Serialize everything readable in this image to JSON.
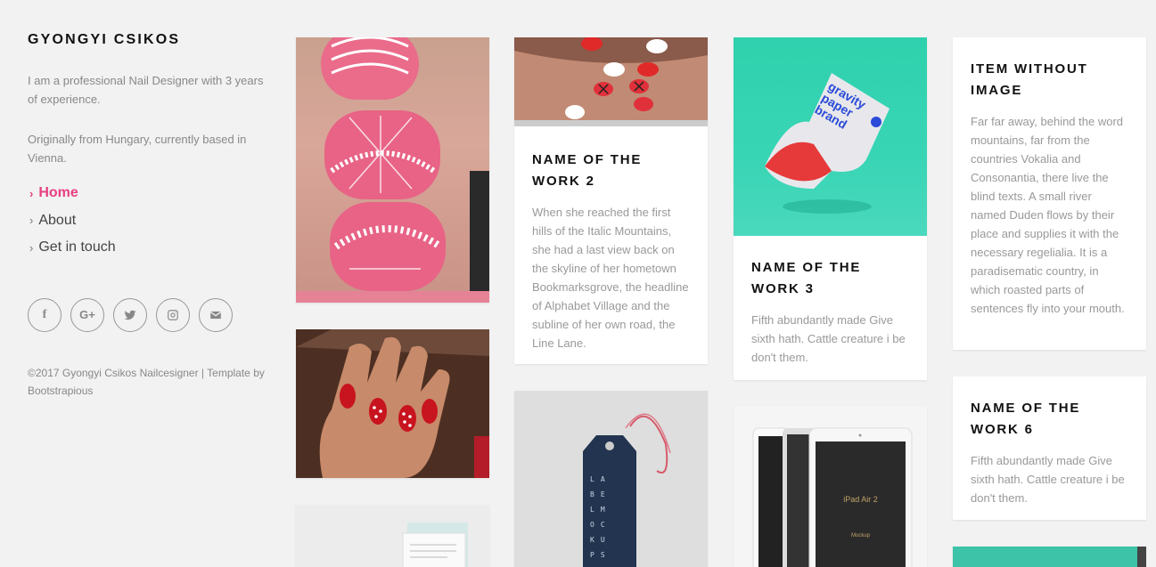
{
  "sidebar": {
    "title": "GYONGYI CSIKOS",
    "bio_1": "I am a professional Nail Designer with 3 years of experience.",
    "bio_2": "Originally from Hungary, currently based in Vienna.",
    "nav": [
      {
        "label": "Home",
        "active": true
      },
      {
        "label": "About",
        "active": false
      },
      {
        "label": "Get in touch",
        "active": false
      }
    ],
    "social": [
      "facebook-icon",
      "google-plus-icon",
      "twitter-icon",
      "instagram-icon",
      "email-icon"
    ],
    "copyright": "©2017 Gyongyi Csikos Nailcesigner | Template by Bootstrapious"
  },
  "cards": {
    "work2": {
      "title": "NAME OF THE WORK 2",
      "text": "When she reached the first hills of the Italic Mountains, she had a last view back on the skyline of her hometown Bookmarksgrove, the headline of Alphabet Village and the subline of her own road, the Line Lane."
    },
    "work3": {
      "title": "NAME OF THE WORK 3",
      "text": "Fifth abundantly made Give sixth hath. Cattle creature i be don't them."
    },
    "noimage": {
      "title": "ITEM WITHOUT IMAGE",
      "text": "Far far away, behind the word mountains, far from the countries Vokalia and Consonantia, there live the blind texts. A small river named Duden flows by their place and supplies it with the necessary regelialia. It is a paradisematic country, in which roasted parts of sentences fly into your mouth."
    },
    "work6": {
      "title": "NAME OF THE WORK 6",
      "text": "Fifth abundantly made Give sixth hath. Cattle creature i be don't them."
    }
  },
  "image_text": {
    "paper_brand": "gravity paper brand",
    "tag_letters": [
      "LA",
      "BE",
      "LM",
      "OC",
      "KU",
      "PS"
    ],
    "tablet_title": "iPad Air 2",
    "tablet_sub": "Mockup"
  },
  "colors": {
    "accent": "#e8407f",
    "background": "#f2f2f2",
    "teal": "#2fd1ad"
  }
}
